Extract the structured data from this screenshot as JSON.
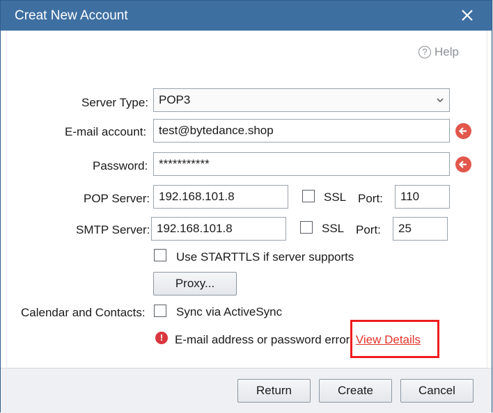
{
  "window": {
    "title": "Creat New Account"
  },
  "help": {
    "label": "Help"
  },
  "server_type": {
    "label": "Server Type:",
    "value": "POP3"
  },
  "email": {
    "label": "E-mail account:",
    "value": "test@bytedance.shop"
  },
  "password": {
    "label": "Password:",
    "value": "***********"
  },
  "pop": {
    "label": "POP Server:",
    "value": "192.168.101.8",
    "ssl_label": "SSL",
    "port_label": "Port:",
    "port": "110"
  },
  "smtp": {
    "label": "SMTP Server:",
    "value": "192.168.101.8",
    "ssl_label": "SSL",
    "port_label": "Port:",
    "port": "25"
  },
  "starttls": {
    "label": "Use STARTTLS if server supports"
  },
  "proxy": {
    "label": "Proxy..."
  },
  "calendar": {
    "label": "Calendar and Contacts:",
    "sync_label": "Sync via ActiveSync"
  },
  "error": {
    "message": "E-mail address or password error.",
    "link": "View Details"
  },
  "buttons": {
    "return": "Return",
    "create": "Create",
    "cancel": "Cancel"
  },
  "colors": {
    "titlebar": "#3e6fa1",
    "error": "#e2574c",
    "link": "#e0332b",
    "highlight": "#ee1c1c"
  }
}
